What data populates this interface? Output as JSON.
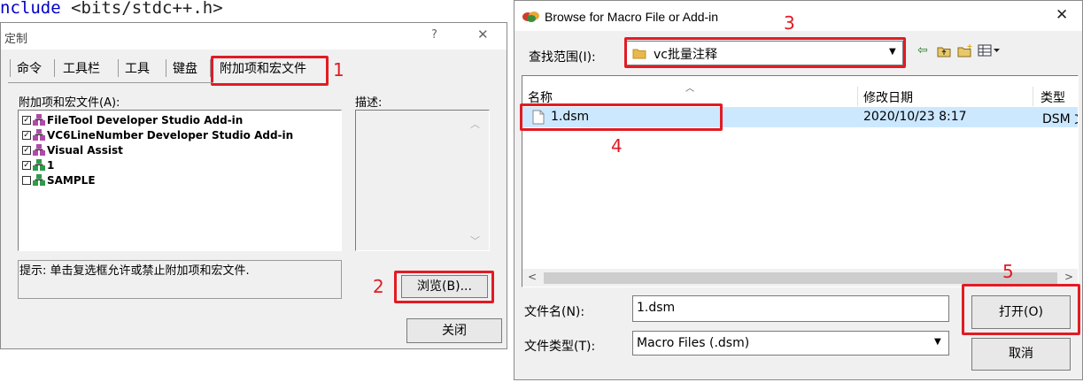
{
  "background_code": {
    "keyword": "nclude",
    "rest": " <bits/stdc++.h>"
  },
  "customize_dialog": {
    "title": "定制",
    "help_glyph": "?",
    "close_glyph": "✕",
    "tabs": [
      "命令",
      "工具栏",
      "工具",
      "键盘",
      "附加项和宏文件"
    ],
    "list_label": "附加项和宏文件(A):",
    "items": [
      {
        "label": "FileTool Developer Studio Add-in",
        "checked": true,
        "icon": "addin-icon"
      },
      {
        "label": "VC6LineNumber Developer Studio Add-in",
        "checked": true,
        "icon": "addin-icon"
      },
      {
        "label": "Visual Assist",
        "checked": true,
        "icon": "addin-icon"
      },
      {
        "label": "1",
        "checked": true,
        "icon": "macro-icon"
      },
      {
        "label": "SAMPLE",
        "checked": false,
        "icon": "macro-icon"
      }
    ],
    "description_label": "描述:",
    "hint": "提示: 单击复选框允许或禁止附加项和宏文件.",
    "browse_button": "浏览(B)...",
    "close_button": "关闭"
  },
  "browse_dialog": {
    "title": "Browse for Macro File or Add-in",
    "close_glyph": "✕",
    "look_in_label": "查找范围(I):",
    "look_in_value": "vc批量注释",
    "columns": [
      "名称",
      "修改日期",
      "类型"
    ],
    "files": [
      {
        "name": "1.dsm",
        "modified": "2020/10/23 8:17",
        "type": "DSM 文"
      }
    ],
    "filename_label": "文件名(N):",
    "filename_value": "1.dsm",
    "filetype_label": "文件类型(T):",
    "filetype_value": "Macro Files (.dsm)",
    "open_button": "打开(O)",
    "cancel_button": "取消"
  },
  "annotations": [
    "1",
    "2",
    "3",
    "4",
    "5"
  ],
  "colors": {
    "annotation_red": "#e21b23",
    "selection_blue": "#cce8ff",
    "code_keyword": "#0000c8",
    "folder_yellow": "#e8b84a"
  }
}
